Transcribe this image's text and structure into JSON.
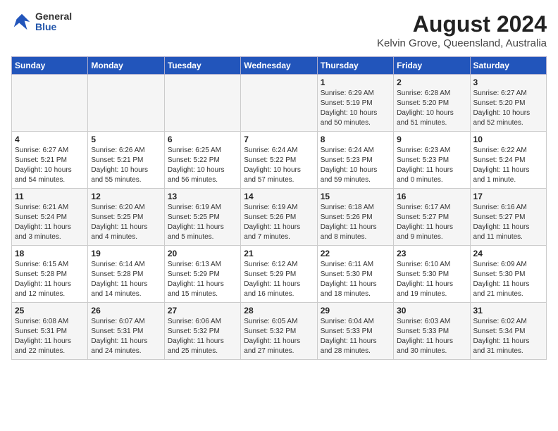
{
  "header": {
    "logo": {
      "general": "General",
      "blue": "Blue"
    },
    "title": "August 2024",
    "subtitle": "Kelvin Grove, Queensland, Australia"
  },
  "weekdays": [
    "Sunday",
    "Monday",
    "Tuesday",
    "Wednesday",
    "Thursday",
    "Friday",
    "Saturday"
  ],
  "weeks": [
    [
      {
        "day": "",
        "content": ""
      },
      {
        "day": "",
        "content": ""
      },
      {
        "day": "",
        "content": ""
      },
      {
        "day": "",
        "content": ""
      },
      {
        "day": "1",
        "content": "Sunrise: 6:29 AM\nSunset: 5:19 PM\nDaylight: 10 hours\nand 50 minutes."
      },
      {
        "day": "2",
        "content": "Sunrise: 6:28 AM\nSunset: 5:20 PM\nDaylight: 10 hours\nand 51 minutes."
      },
      {
        "day": "3",
        "content": "Sunrise: 6:27 AM\nSunset: 5:20 PM\nDaylight: 10 hours\nand 52 minutes."
      }
    ],
    [
      {
        "day": "4",
        "content": "Sunrise: 6:27 AM\nSunset: 5:21 PM\nDaylight: 10 hours\nand 54 minutes."
      },
      {
        "day": "5",
        "content": "Sunrise: 6:26 AM\nSunset: 5:21 PM\nDaylight: 10 hours\nand 55 minutes."
      },
      {
        "day": "6",
        "content": "Sunrise: 6:25 AM\nSunset: 5:22 PM\nDaylight: 10 hours\nand 56 minutes."
      },
      {
        "day": "7",
        "content": "Sunrise: 6:24 AM\nSunset: 5:22 PM\nDaylight: 10 hours\nand 57 minutes."
      },
      {
        "day": "8",
        "content": "Sunrise: 6:24 AM\nSunset: 5:23 PM\nDaylight: 10 hours\nand 59 minutes."
      },
      {
        "day": "9",
        "content": "Sunrise: 6:23 AM\nSunset: 5:23 PM\nDaylight: 11 hours\nand 0 minutes."
      },
      {
        "day": "10",
        "content": "Sunrise: 6:22 AM\nSunset: 5:24 PM\nDaylight: 11 hours\nand 1 minute."
      }
    ],
    [
      {
        "day": "11",
        "content": "Sunrise: 6:21 AM\nSunset: 5:24 PM\nDaylight: 11 hours\nand 3 minutes."
      },
      {
        "day": "12",
        "content": "Sunrise: 6:20 AM\nSunset: 5:25 PM\nDaylight: 11 hours\nand 4 minutes."
      },
      {
        "day": "13",
        "content": "Sunrise: 6:19 AM\nSunset: 5:25 PM\nDaylight: 11 hours\nand 5 minutes."
      },
      {
        "day": "14",
        "content": "Sunrise: 6:19 AM\nSunset: 5:26 PM\nDaylight: 11 hours\nand 7 minutes."
      },
      {
        "day": "15",
        "content": "Sunrise: 6:18 AM\nSunset: 5:26 PM\nDaylight: 11 hours\nand 8 minutes."
      },
      {
        "day": "16",
        "content": "Sunrise: 6:17 AM\nSunset: 5:27 PM\nDaylight: 11 hours\nand 9 minutes."
      },
      {
        "day": "17",
        "content": "Sunrise: 6:16 AM\nSunset: 5:27 PM\nDaylight: 11 hours\nand 11 minutes."
      }
    ],
    [
      {
        "day": "18",
        "content": "Sunrise: 6:15 AM\nSunset: 5:28 PM\nDaylight: 11 hours\nand 12 minutes."
      },
      {
        "day": "19",
        "content": "Sunrise: 6:14 AM\nSunset: 5:28 PM\nDaylight: 11 hours\nand 14 minutes."
      },
      {
        "day": "20",
        "content": "Sunrise: 6:13 AM\nSunset: 5:29 PM\nDaylight: 11 hours\nand 15 minutes."
      },
      {
        "day": "21",
        "content": "Sunrise: 6:12 AM\nSunset: 5:29 PM\nDaylight: 11 hours\nand 16 minutes."
      },
      {
        "day": "22",
        "content": "Sunrise: 6:11 AM\nSunset: 5:30 PM\nDaylight: 11 hours\nand 18 minutes."
      },
      {
        "day": "23",
        "content": "Sunrise: 6:10 AM\nSunset: 5:30 PM\nDaylight: 11 hours\nand 19 minutes."
      },
      {
        "day": "24",
        "content": "Sunrise: 6:09 AM\nSunset: 5:30 PM\nDaylight: 11 hours\nand 21 minutes."
      }
    ],
    [
      {
        "day": "25",
        "content": "Sunrise: 6:08 AM\nSunset: 5:31 PM\nDaylight: 11 hours\nand 22 minutes."
      },
      {
        "day": "26",
        "content": "Sunrise: 6:07 AM\nSunset: 5:31 PM\nDaylight: 11 hours\nand 24 minutes."
      },
      {
        "day": "27",
        "content": "Sunrise: 6:06 AM\nSunset: 5:32 PM\nDaylight: 11 hours\nand 25 minutes."
      },
      {
        "day": "28",
        "content": "Sunrise: 6:05 AM\nSunset: 5:32 PM\nDaylight: 11 hours\nand 27 minutes."
      },
      {
        "day": "29",
        "content": "Sunrise: 6:04 AM\nSunset: 5:33 PM\nDaylight: 11 hours\nand 28 minutes."
      },
      {
        "day": "30",
        "content": "Sunrise: 6:03 AM\nSunset: 5:33 PM\nDaylight: 11 hours\nand 30 minutes."
      },
      {
        "day": "31",
        "content": "Sunrise: 6:02 AM\nSunset: 5:34 PM\nDaylight: 11 hours\nand 31 minutes."
      }
    ]
  ]
}
